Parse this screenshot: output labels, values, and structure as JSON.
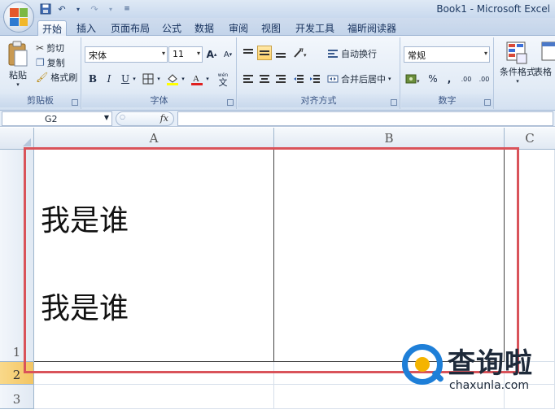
{
  "window": {
    "title": "Book1 - Microsoft Excel"
  },
  "tabs": [
    {
      "label": "开始",
      "active": true
    },
    {
      "label": "插入"
    },
    {
      "label": "页面布局"
    },
    {
      "label": "公式"
    },
    {
      "label": "数据"
    },
    {
      "label": "审阅"
    },
    {
      "label": "视图"
    },
    {
      "label": "开发工具"
    },
    {
      "label": "福昕阅读器"
    }
  ],
  "ribbon": {
    "clipboard": {
      "paste": "粘贴",
      "cut": "剪切",
      "copy": "复制",
      "format_painter": "格式刷",
      "label": "剪贴板"
    },
    "font": {
      "name": "宋体",
      "size": "11",
      "bold": "B",
      "italic": "I",
      "underline": "U",
      "label": "字体",
      "wen": "wén",
      "wen_char": "文"
    },
    "alignment": {
      "wrap": "自动换行",
      "merge": "合并后居中",
      "label": "对齐方式"
    },
    "number": {
      "format": "常规",
      "percent": "%",
      "comma": ",",
      "inc_dec": ".00",
      "dec_dec": ".00",
      "label": "数字"
    },
    "styles": {
      "conditional": "条件格式",
      "table": "表格"
    }
  },
  "formula_bar": {
    "name_box": "G2",
    "fx": "fx",
    "value": ""
  },
  "sheet": {
    "columns": [
      "A",
      "B",
      "C"
    ],
    "rows": [
      "1",
      "2",
      "3"
    ],
    "selected_row": "2",
    "a1_line1": "我是谁",
    "a1_line2": "我是谁"
  },
  "watermark": {
    "cn": "查询啦",
    "en": "chaxunla.com"
  },
  "colors": {
    "highlight": "#d9535a",
    "watermark_blue": "#1e7fd8",
    "watermark_yellow": "#f4b400"
  }
}
